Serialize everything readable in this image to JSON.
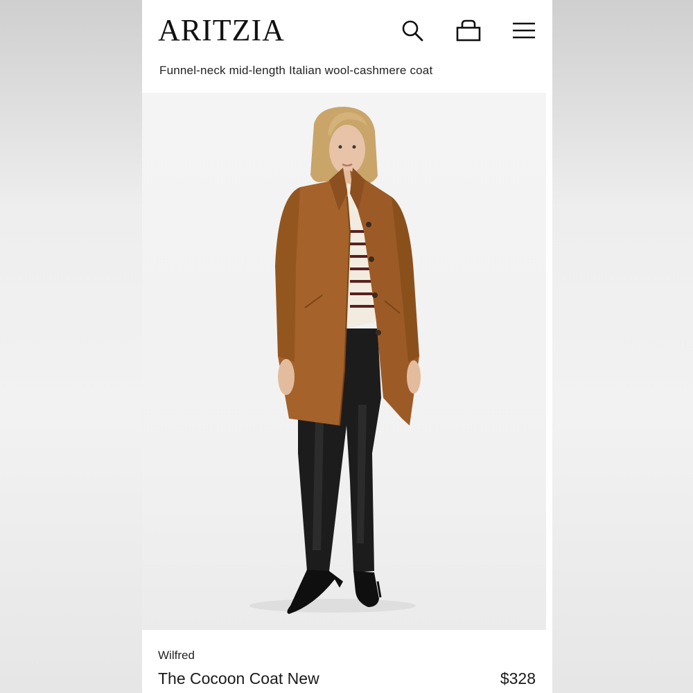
{
  "header": {
    "logo": "ARITZIA",
    "icons": [
      "search-icon",
      "bag-icon",
      "menu-icon"
    ]
  },
  "product": {
    "subtitle": "Funnel-neck mid-length Italian wool-cashmere coat",
    "brand": "Wilfred",
    "name": "The Cocoon Coat New",
    "price": "$328",
    "coat_color": "#a5622a"
  },
  "colors": {
    "page_bg": "#ffffff",
    "text": "#1a1a1a",
    "coat": "#a5622a",
    "pants": "#1c1c1c"
  }
}
